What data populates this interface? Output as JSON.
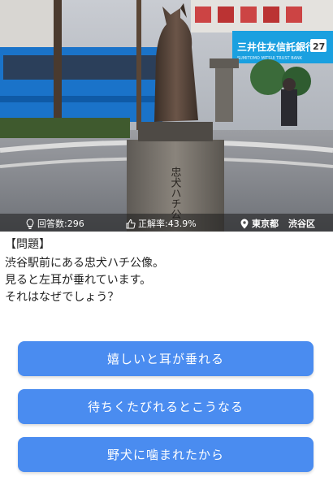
{
  "photo": {
    "subject": "hachiko-statue-photo",
    "background_sign_text": "三井住友信託銀行",
    "background_sign_subtext": "SUMITOMO MITSUI TRUST BANK",
    "sign_number": "27",
    "pedestal_inscription": "忠犬ハチ公"
  },
  "stats": {
    "answers_label": "回答数:296",
    "accuracy_label": "正解率:43.9%",
    "location_prefecture": "東京都",
    "location_ward": "渋谷区"
  },
  "question": {
    "heading": "【問題】",
    "lines": [
      "渋谷駅前にある忠犬ハチ公像。",
      "見ると左耳が垂れています。",
      "それはなぜでしょう？"
    ]
  },
  "choices": [
    {
      "label": "嬉しいと耳が垂れる"
    },
    {
      "label": "待ちくたびれるとこうなる"
    },
    {
      "label": "野犬に噛まれたから"
    }
  ],
  "colors": {
    "button": "#4a8cf0",
    "sign_blue": "#1aa0e0",
    "bus_blue": "#1a73c9"
  },
  "icons": {
    "answers": "lightbulb-icon",
    "accuracy": "thumbs-up-icon",
    "location": "map-pin-icon"
  }
}
